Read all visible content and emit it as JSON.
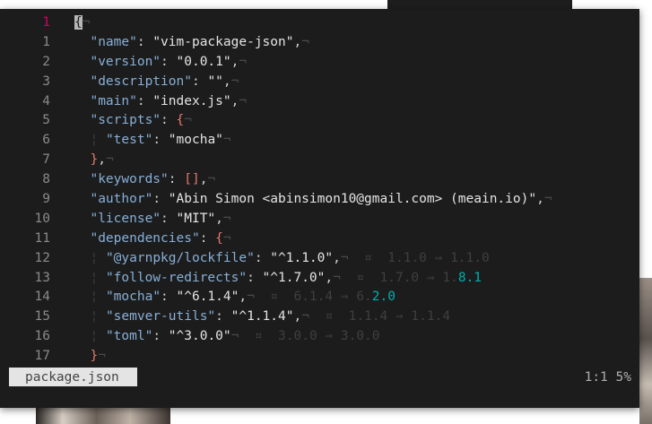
{
  "window": {
    "filename": "package.json",
    "position": "1:1",
    "percent": "5%"
  },
  "lines": [
    {
      "num": "1",
      "current": true,
      "segments": [
        {
          "t": "{",
          "c": "brace cursor"
        },
        {
          "t": "¬",
          "c": "eol"
        }
      ]
    },
    {
      "num": "1",
      "segments": [
        {
          "t": "  ",
          "c": ""
        },
        {
          "t": "\"name\"",
          "c": "key"
        },
        {
          "t": ": ",
          "c": "punct"
        },
        {
          "t": "\"vim-package-json\"",
          "c": "str"
        },
        {
          "t": ",",
          "c": "punct"
        },
        {
          "t": "¬",
          "c": "eol"
        }
      ]
    },
    {
      "num": "2",
      "segments": [
        {
          "t": "  ",
          "c": ""
        },
        {
          "t": "\"version\"",
          "c": "key"
        },
        {
          "t": ": ",
          "c": "punct"
        },
        {
          "t": "\"0.0.1\"",
          "c": "str"
        },
        {
          "t": ",",
          "c": "punct"
        },
        {
          "t": "¬",
          "c": "eol"
        }
      ]
    },
    {
      "num": "3",
      "segments": [
        {
          "t": "  ",
          "c": ""
        },
        {
          "t": "\"description\"",
          "c": "key"
        },
        {
          "t": ": ",
          "c": "punct"
        },
        {
          "t": "\"\"",
          "c": "str"
        },
        {
          "t": ",",
          "c": "punct"
        },
        {
          "t": "¬",
          "c": "eol"
        }
      ]
    },
    {
      "num": "4",
      "segments": [
        {
          "t": "  ",
          "c": ""
        },
        {
          "t": "\"main\"",
          "c": "key"
        },
        {
          "t": ": ",
          "c": "punct"
        },
        {
          "t": "\"index.js\"",
          "c": "str"
        },
        {
          "t": ",",
          "c": "punct"
        },
        {
          "t": "¬",
          "c": "eol"
        }
      ]
    },
    {
      "num": "5",
      "segments": [
        {
          "t": "  ",
          "c": ""
        },
        {
          "t": "\"scripts\"",
          "c": "key"
        },
        {
          "t": ": ",
          "c": "punct"
        },
        {
          "t": "{",
          "c": "brace"
        },
        {
          "t": "¬",
          "c": "eol"
        }
      ]
    },
    {
      "num": "6",
      "segments": [
        {
          "t": "  ",
          "c": ""
        },
        {
          "t": "¦ ",
          "c": "indent"
        },
        {
          "t": "\"test\"",
          "c": "key"
        },
        {
          "t": ": ",
          "c": "punct"
        },
        {
          "t": "\"mocha\"",
          "c": "str"
        },
        {
          "t": "¬",
          "c": "eol"
        }
      ]
    },
    {
      "num": "7",
      "segments": [
        {
          "t": "  ",
          "c": ""
        },
        {
          "t": "}",
          "c": "brace"
        },
        {
          "t": ",",
          "c": "punct"
        },
        {
          "t": "¬",
          "c": "eol"
        }
      ]
    },
    {
      "num": "8",
      "segments": [
        {
          "t": "  ",
          "c": ""
        },
        {
          "t": "\"keywords\"",
          "c": "key"
        },
        {
          "t": ": ",
          "c": "punct"
        },
        {
          "t": "[]",
          "c": "brace"
        },
        {
          "t": ",",
          "c": "punct"
        },
        {
          "t": "¬",
          "c": "eol"
        }
      ]
    },
    {
      "num": "9",
      "segments": [
        {
          "t": "  ",
          "c": ""
        },
        {
          "t": "\"author\"",
          "c": "key"
        },
        {
          "t": ": ",
          "c": "punct"
        },
        {
          "t": "\"Abin Simon <abinsimon10@gmail.com> (meain.io)\"",
          "c": "str"
        },
        {
          "t": ",",
          "c": "punct"
        },
        {
          "t": "¬",
          "c": "eol"
        }
      ]
    },
    {
      "num": "10",
      "segments": [
        {
          "t": "  ",
          "c": ""
        },
        {
          "t": "\"license\"",
          "c": "key"
        },
        {
          "t": ": ",
          "c": "punct"
        },
        {
          "t": "\"MIT\"",
          "c": "str"
        },
        {
          "t": ",",
          "c": "punct"
        },
        {
          "t": "¬",
          "c": "eol"
        }
      ]
    },
    {
      "num": "11",
      "segments": [
        {
          "t": "  ",
          "c": ""
        },
        {
          "t": "\"dependencies\"",
          "c": "key"
        },
        {
          "t": ": ",
          "c": "punct"
        },
        {
          "t": "{",
          "c": "brace"
        },
        {
          "t": "¬",
          "c": "eol"
        }
      ]
    },
    {
      "num": "12",
      "segments": [
        {
          "t": "  ",
          "c": ""
        },
        {
          "t": "¦ ",
          "c": "indent"
        },
        {
          "t": "\"@yarnpkg/lockfile\"",
          "c": "key"
        },
        {
          "t": ": ",
          "c": "punct"
        },
        {
          "t": "\"^1.1.0\"",
          "c": "str"
        },
        {
          "t": ",",
          "c": "punct"
        },
        {
          "t": "¬",
          "c": "eol"
        },
        {
          "t": "  ¤  1.1.0 ⇒ 1.1.0",
          "c": "hint"
        }
      ]
    },
    {
      "num": "13",
      "segments": [
        {
          "t": "  ",
          "c": ""
        },
        {
          "t": "¦ ",
          "c": "indent"
        },
        {
          "t": "\"follow-redirects\"",
          "c": "key"
        },
        {
          "t": ": ",
          "c": "punct"
        },
        {
          "t": "\"^1.7.0\"",
          "c": "str"
        },
        {
          "t": ",",
          "c": "punct"
        },
        {
          "t": "¬",
          "c": "eol"
        },
        {
          "t": "  ¤  1.7.0 ⇒ 1.",
          "c": "hint"
        },
        {
          "t": "8.1",
          "c": "hint-major"
        }
      ]
    },
    {
      "num": "14",
      "segments": [
        {
          "t": "  ",
          "c": ""
        },
        {
          "t": "¦ ",
          "c": "indent"
        },
        {
          "t": "\"mocha\"",
          "c": "key"
        },
        {
          "t": ": ",
          "c": "punct"
        },
        {
          "t": "\"^6.1.4\"",
          "c": "str"
        },
        {
          "t": ",",
          "c": "punct"
        },
        {
          "t": "¬",
          "c": "eol"
        },
        {
          "t": "  ¤  6.1.4 ⇒ 6.",
          "c": "hint"
        },
        {
          "t": "2.0",
          "c": "hint-major"
        }
      ]
    },
    {
      "num": "15",
      "segments": [
        {
          "t": "  ",
          "c": ""
        },
        {
          "t": "¦ ",
          "c": "indent"
        },
        {
          "t": "\"semver-utils\"",
          "c": "key"
        },
        {
          "t": ": ",
          "c": "punct"
        },
        {
          "t": "\"^1.1.4\"",
          "c": "str"
        },
        {
          "t": ",",
          "c": "punct"
        },
        {
          "t": "¬",
          "c": "eol"
        },
        {
          "t": "  ¤  1.1.4 ⇒ 1.1.4",
          "c": "hint"
        }
      ]
    },
    {
      "num": "16",
      "segments": [
        {
          "t": "  ",
          "c": ""
        },
        {
          "t": "¦ ",
          "c": "indent"
        },
        {
          "t": "\"toml\"",
          "c": "key"
        },
        {
          "t": ": ",
          "c": "punct"
        },
        {
          "t": "\"^3.0.0\"",
          "c": "str"
        },
        {
          "t": "¬",
          "c": "eol"
        },
        {
          "t": "  ¤  3.0.0 ⇒ 3.0.0",
          "c": "hint"
        }
      ]
    },
    {
      "num": "17",
      "segments": [
        {
          "t": "  ",
          "c": ""
        },
        {
          "t": "}",
          "c": "brace"
        },
        {
          "t": "¬",
          "c": "eol"
        }
      ]
    }
  ]
}
